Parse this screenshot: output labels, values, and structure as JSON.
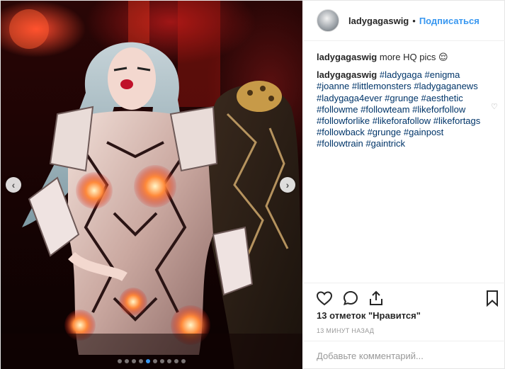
{
  "post": {
    "author": "ladygagaswig",
    "separator": "•",
    "follow_label": "Подписаться",
    "caption": {
      "author": "ladygagaswig",
      "text": "more HQ pics 😌"
    },
    "hashtag_comment": {
      "author": "ladygagaswig",
      "lines": [
        [
          "#ladygaga",
          "#enigma"
        ],
        [
          "#joanne",
          "#littlemonsters",
          "#ladygaganews"
        ],
        [
          "#ladygaga4ever",
          "#grunge",
          "#aesthetic"
        ],
        [
          "#followme",
          "#followteam",
          "#likeforfollow"
        ],
        [
          "#followforlike",
          "#likeforafollow",
          "#likefortags"
        ],
        [
          "#followback",
          "#grunge",
          "#gainpost"
        ],
        [
          "#followtrain",
          "#gaintrick"
        ]
      ]
    },
    "likes_text": "13 отметок \"Нравится\"",
    "timestamp": "13 МИНУТ НАЗАД",
    "comment_placeholder": "Добавьте комментарий...",
    "carousel": {
      "total": 10,
      "active_index": 4
    },
    "icons": {
      "like": "heart-icon",
      "comment": "comment-bubble-icon",
      "share": "share-icon",
      "save": "bookmark-icon",
      "prev": "chevron-left-icon",
      "next": "chevron-right-icon"
    },
    "colors": {
      "link": "#3897f0",
      "hashtag": "#003569",
      "muted": "#999999"
    }
  }
}
